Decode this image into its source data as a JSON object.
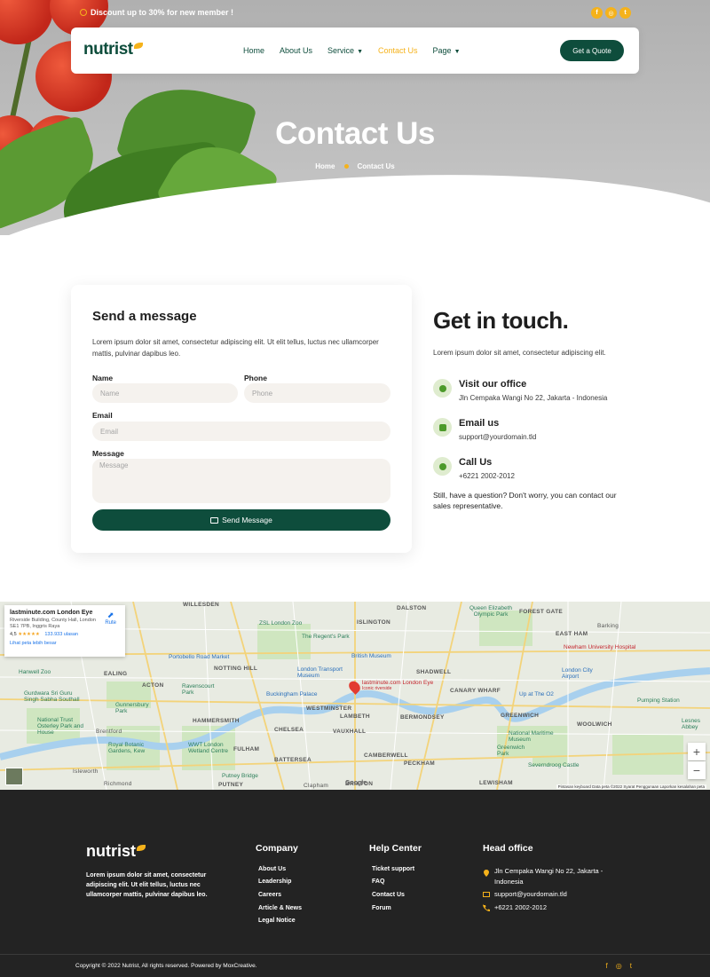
{
  "topbar": {
    "promo": "Discount up to 30% for new member !",
    "social": [
      "f",
      "◎",
      "t"
    ]
  },
  "nav": {
    "logo": "nutrist",
    "links": [
      "Home",
      "About Us",
      "Service",
      "Contact Us",
      "Page"
    ],
    "cta": "Get a Quote"
  },
  "hero": {
    "title": "Contact Us",
    "breadcrumb_home": "Home",
    "breadcrumb_current": "Contact Us"
  },
  "form": {
    "title": "Send a message",
    "description": "Lorem ipsum dolor sit amet, consectetur adipiscing elit. Ut elit tellus, luctus nec ullamcorper mattis, pulvinar dapibus leo.",
    "name_label": "Name",
    "name_placeholder": "Name",
    "phone_label": "Phone",
    "phone_placeholder": "Phone",
    "email_label": "Email",
    "email_placeholder": "Email",
    "message_label": "Message",
    "message_placeholder": "Message",
    "submit": "Send Message"
  },
  "touch": {
    "title": "Get in touch.",
    "description": "Lorem ipsum dolor sit amet, consectetur adipiscing elit.",
    "office_title": "Visit our office",
    "office_value": "Jln Cempaka Wangi No 22, Jakarta - Indonesia",
    "email_title": "Email us",
    "email_value": "support@yourdomain.tld",
    "call_title": "Call Us",
    "call_value": "+6221 2002-2012",
    "footer_note": "Still, have a question? Don't worry, you can contact our sales representative."
  },
  "map": {
    "infobox_title": "lastminute.com London Eye",
    "infobox_address": "Riverside Building, County Hall, London SE1 7PB, Inggris Raya",
    "infobox_rating": "4,5",
    "infobox_stars": "★★★★★",
    "infobox_reviews": "133.933 ulasan",
    "infobox_link": "Lihat peta lebih besar",
    "infobox_route": "Rute",
    "pin_label": "lastminute.com London Eye",
    "pin_sub": "Iconic riverside",
    "areas": [
      "WILLESDEN",
      "DALSTON",
      "FOREST GATE",
      "ISLINGTON",
      "EAST HAM",
      "NOTTING HILL",
      "EALING",
      "ACTON",
      "SHADWELL",
      "CANARY WHARF",
      "WESTMINSTER",
      "LAMBETH",
      "BERMONDSEY",
      "HAMMERSMITH",
      "CHELSEA",
      "VAUXHALL",
      "GREENWICH",
      "WOOLWICH",
      "FULHAM",
      "BATTERSEA",
      "CAMBERWELL",
      "PECKHAM",
      "PUTNEY",
      "BRIXTON",
      "LEWISHAM",
      "Richmond",
      "Isleworth",
      "Clapham",
      "Barking",
      "Brentford"
    ],
    "pois": [
      "ZSL London Zoo",
      "The Regent's Park",
      "British Museum",
      "Portobello Road Market",
      "London Transport Museum",
      "Buckingham Palace",
      "Gunnersbury Park",
      "Ravenscourt Park",
      "Royal Botanic Gardens, Kew",
      "WWT London Wetland Centre",
      "Newham University Hospital",
      "London City Airport",
      "Up at The O2",
      "National Maritime Museum",
      "Greenwich Park",
      "Severndroog Castle",
      "Hanwell Zoo",
      "Queen Elizabeth Olympic Park",
      "Pumping Station",
      "Lesnes Abbey",
      "Gurdwara Sri Guru Singh Sabha Southall",
      "National Trust Osterley Park and House",
      "Putney Bridge"
    ],
    "footer": "Pintasan keyboard   Data peta ©2022   Syarat Penggunaan   Laporkan kesalahan peta",
    "google": "Google",
    "zoom_in": "+",
    "zoom_out": "−"
  },
  "footer": {
    "logo": "nutrist",
    "description": "Lorem ipsum dolor sit amet, consectetur adipiscing elit. Ut elit tellus, luctus nec ullamcorper mattis, pulvinar dapibus leo.",
    "company_title": "Company",
    "company_links": [
      "About Us",
      "Leadership",
      "Careers",
      "Article & News",
      "Legal Notice"
    ],
    "help_title": "Help Center",
    "help_links": [
      "Ticket support",
      "FAQ",
      "Contact Us",
      "Forum"
    ],
    "office_title": "Head office",
    "office_address": "Jln Cempaka Wangi No 22, Jakarta - Indonesia",
    "office_email": "support@yourdomain.tld",
    "office_phone": "+6221 2002-2012",
    "copyright": "Copyright © 2022 Nutrist, All rights reserved. Powered by MoxCreative.",
    "social": [
      "f",
      "◎",
      "t"
    ]
  },
  "colors": {
    "primary": "#0e4d3c",
    "accent": "#f5b21b",
    "footer_bg": "#232323",
    "field_bg": "#f5f2ee"
  },
  "icons": [
    "promo-icon",
    "facebook-icon",
    "instagram-icon",
    "twitter-icon",
    "chevron-down-icon",
    "mail-icon",
    "chat-icon",
    "phone-icon",
    "location-icon",
    "map-pin-icon",
    "route-icon"
  ]
}
